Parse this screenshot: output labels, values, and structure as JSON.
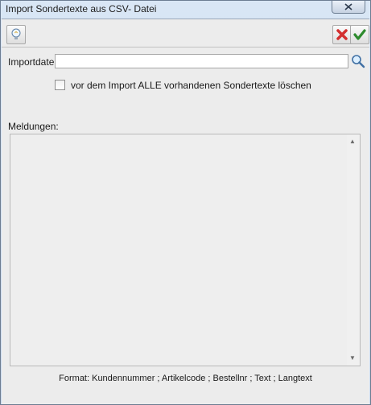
{
  "window": {
    "title": "Import Sondertexte aus CSV- Datei"
  },
  "toolbar": {
    "info_icon": "lightbulb-icon",
    "cancel_icon": "red-x-icon",
    "ok_icon": "green-check-icon"
  },
  "form": {
    "import_label": "Importdatei",
    "import_value": "",
    "checkbox_label": "vor dem Import ALLE vorhandenen Sondertexte löschen",
    "checkbox_checked": false,
    "messages_label": "Meldungen:"
  },
  "footer": {
    "format_text": "Format: Kundennummer ; Artikelcode ; Bestellnr ; Text ; Langtext"
  },
  "colors": {
    "cancel": "#d32f2f",
    "ok": "#2e8b2e"
  }
}
